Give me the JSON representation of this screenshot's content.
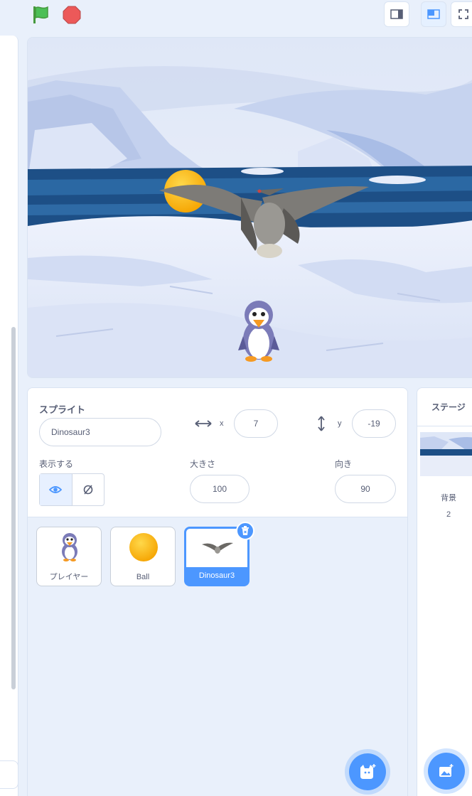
{
  "sprite_panel": {
    "title": "スプライト",
    "name_value": "Dinosaur3",
    "x_label": "x",
    "x_value": "7",
    "y_label": "y",
    "y_value": "-19",
    "show_label": "表示する",
    "size_label": "大きさ",
    "size_value": "100",
    "direction_label": "向き",
    "direction_value": "90"
  },
  "sprites": [
    {
      "name": "プレイヤー",
      "icon": "penguin-icon"
    },
    {
      "name": "Ball",
      "icon": "ball-icon"
    },
    {
      "name": "Dinosaur3",
      "icon": "pterodactyl-icon",
      "selected": true
    }
  ],
  "stage_panel": {
    "title": "ステージ",
    "backdrop_label": "背景",
    "backdrop_count": "2"
  },
  "colors": {
    "accent": "#4c97ff",
    "panel_bg": "#e9f0fb",
    "green_flag": "#4cbf56",
    "stop": "#ec5959"
  }
}
